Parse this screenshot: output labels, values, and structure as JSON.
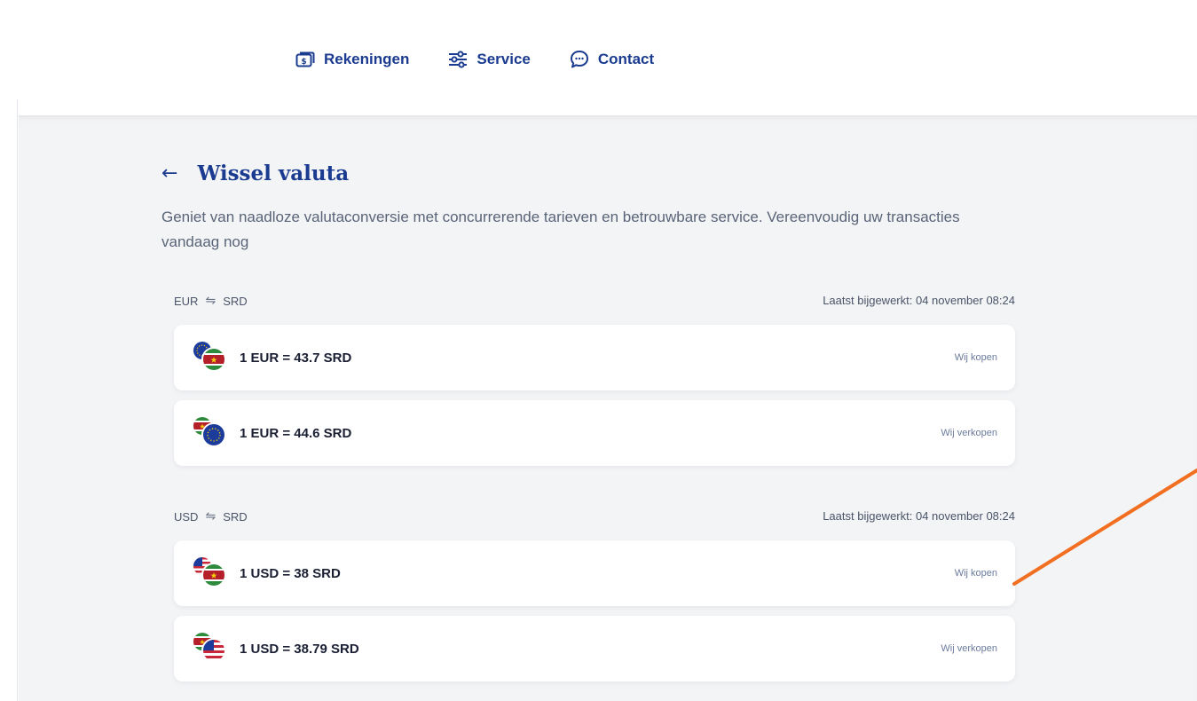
{
  "nav": {
    "items": [
      {
        "label": "Rekeningen",
        "icon": "bill-icon"
      },
      {
        "label": "Service",
        "icon": "sliders-icon"
      },
      {
        "label": "Contact",
        "icon": "chat-bubble-icon"
      }
    ]
  },
  "header": {
    "back_icon": "arrow-left-icon",
    "title": "Wissel valuta",
    "description": "Geniet van naadloze valutaconversie met concurrerende tarieven en betrouwbare service. Vereenvoudig uw transacties vandaag nog"
  },
  "sections": [
    {
      "from": "EUR",
      "to": "SRD",
      "swap_icon": "swap-arrows-icon",
      "updated": "Laatst bijgewerkt: 04 november 08:24",
      "rates": [
        {
          "text": "1 EUR = 43.7 SRD",
          "action": "Wij kopen",
          "back_flag": "eu-flag-icon",
          "front_flag": "suriname-flag-icon"
        },
        {
          "text": "1 EUR = 44.6 SRD",
          "action": "Wij verkopen",
          "back_flag": "suriname-flag-icon",
          "front_flag": "eu-flag-icon"
        }
      ]
    },
    {
      "from": "USD",
      "to": "SRD",
      "swap_icon": "swap-arrows-icon",
      "updated": "Laatst bijgewerkt: 04 november 08:24",
      "rates": [
        {
          "text": "1 USD = 38 SRD",
          "action": "Wij kopen",
          "back_flag": "us-flag-icon",
          "front_flag": "suriname-flag-icon"
        },
        {
          "text": "1 USD = 38.79 SRD",
          "action": "Wij verkopen",
          "back_flag": "suriname-flag-icon",
          "front_flag": "us-flag-icon"
        }
      ]
    }
  ],
  "colors": {
    "brand_blue": "#1a3b8f",
    "background": "#f3f4f6",
    "annotation": "#f26f21"
  }
}
